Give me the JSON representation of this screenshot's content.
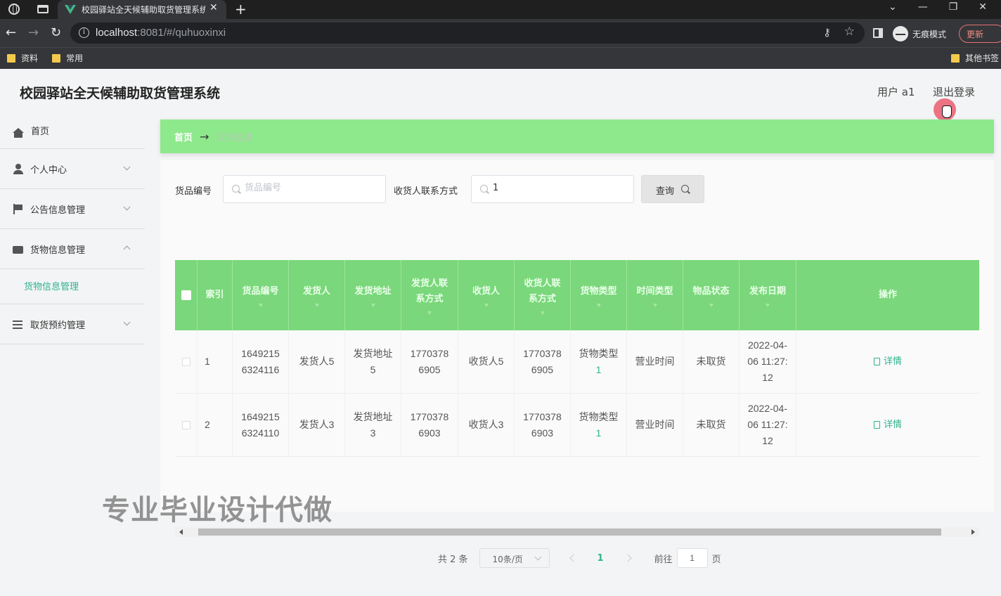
{
  "browser": {
    "tab_title": "校园驿站全天候辅助取货管理系统",
    "url_host": "localhost",
    "url_rest": ":8081/#/quhuoxinxi",
    "incognito_label": "无痕模式",
    "update_label": "更新",
    "bookmarks": [
      {
        "label": "资料"
      },
      {
        "label": "常用"
      },
      {
        "label": "其他书签"
      }
    ]
  },
  "app": {
    "title": "校园驿站全天候辅助取货管理系统",
    "user_label": "用户 a1",
    "logout_label": "退出登录"
  },
  "sidebar": {
    "items": [
      {
        "label": "首页",
        "icon": "home-icon"
      },
      {
        "label": "个人中心",
        "icon": "user-icon"
      },
      {
        "label": "公告信息管理",
        "icon": "flag-icon"
      },
      {
        "label": "货物信息管理",
        "icon": "box-icon"
      },
      {
        "label": "取货预约管理",
        "icon": "list-icon"
      }
    ],
    "submenu_label": "货物信息管理"
  },
  "breadcrumb": {
    "home": "首页",
    "arrow": "→",
    "current": "取货信息"
  },
  "search": {
    "field1_label": "货品编号",
    "field1_placeholder": "货品编号",
    "field1_value": "",
    "field2_label": "收货人联系方式",
    "field2_value": "1",
    "query_label": "查询"
  },
  "table": {
    "columns": [
      "",
      "索引",
      "货品编号",
      "发货人",
      "发货地址",
      "发货人联系方式",
      "收货人",
      "收货人联系方式",
      "货物类型",
      "时间类型",
      "物品状态",
      "发布日期",
      "操作"
    ],
    "rows": [
      {
        "index": "1",
        "goods_no": "16492156324116",
        "sender": "发货人5",
        "sender_addr": "发货地址5",
        "sender_phone": "17703786905",
        "receiver": "收货人5",
        "receiver_phone": "17703786905",
        "goods_type": "货物类型",
        "goods_type_num": "1",
        "time_type": "营业时间",
        "status": "未取货",
        "date": "2022-04-06 11:27:12",
        "action": "详情"
      },
      {
        "index": "2",
        "goods_no": "16492156324110",
        "sender": "发货人3",
        "sender_addr": "发货地址3",
        "sender_phone": "17703786903",
        "receiver": "收货人3",
        "receiver_phone": "17703786903",
        "goods_type": "货物类型",
        "goods_type_num": "1",
        "time_type": "营业时间",
        "status": "未取货",
        "date": "2022-04-06 11:27:12",
        "action": "详情"
      }
    ]
  },
  "pagination": {
    "total": "共 2 条",
    "page_size": "10条/页",
    "current": "1",
    "goto_prefix": "前往",
    "goto_value": "1",
    "goto_suffix": "页"
  },
  "watermark": "专业毕业设计代做",
  "colors": {
    "accent": "#2fb38f",
    "table_header": "#7ad77b",
    "breadcrumb_bg": "#8de98b"
  }
}
